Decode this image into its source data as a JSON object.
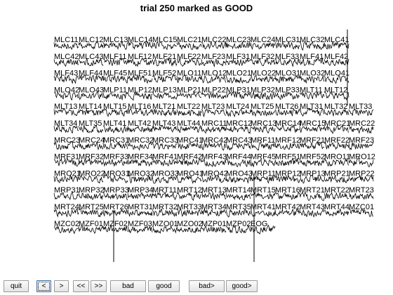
{
  "title": "trial 250 marked as GOOD",
  "channels": [
    [
      "MLC11",
      "MLC12",
      "MLC13",
      "MLC14",
      "MLC15",
      "MLC21",
      "MLC22",
      "MLC23",
      "MLC24",
      "MLC31",
      "MLC32",
      "MLC41"
    ],
    [
      "MLC42",
      "MLC43",
      "MLF11",
      "MLF12",
      "MLF21",
      "MLF22",
      "MLF23",
      "MLF31",
      "MLF32",
      "MLF33",
      "MLF41",
      "MLF42"
    ],
    [
      "MLF43",
      "MLF44",
      "MLF45",
      "MLF51",
      "MLF52",
      "MLO11",
      "MLO12",
      "MLO21",
      "MLO22",
      "MLO31",
      "MLO32",
      "MLO41"
    ],
    [
      "MLO42",
      "MLO43",
      "MLP11",
      "MLP12",
      "MLP13",
      "MLP21",
      "MLP22",
      "MLP31",
      "MLP32",
      "MLP33",
      "MLT11",
      "MLT12"
    ],
    [
      "MLT13",
      "MLT14",
      "MLT15",
      "MLT16",
      "MLT21",
      "MLT22",
      "MLT23",
      "MLT24",
      "MLT25",
      "MLT26",
      "MLT31",
      "MLT32",
      "MLT33"
    ],
    [
      "MLT34",
      "MLT35",
      "MLT41",
      "MLT42",
      "MLT43",
      "MLT44",
      "MRC11",
      "MRC12",
      "MRC13",
      "MRC14",
      "MRC15",
      "MRC21",
      "MRC22"
    ],
    [
      "MRC23",
      "MRC24",
      "MRC31",
      "MRC32",
      "MRC33",
      "MRC41",
      "MRC42",
      "MRC43",
      "MRF11",
      "MRF12",
      "MRF21",
      "MRF22",
      "MRF23"
    ],
    [
      "MRF31",
      "MRF32",
      "MRF33",
      "MRF34",
      "MRF41",
      "MRF42",
      "MRF43",
      "MRF44",
      "MRF45",
      "MRF51",
      "MRF52",
      "MRO11",
      "MRO12"
    ],
    [
      "MRO21",
      "MRO22",
      "MRO31",
      "MRO32",
      "MRO33",
      "MRO41",
      "MRO42",
      "MRO43",
      "MRP11",
      "MRP12",
      "MRP13",
      "MRP21",
      "MRP22"
    ],
    [
      "MRP31",
      "MRP32",
      "MRP33",
      "MRP34",
      "MRT11",
      "MRT12",
      "MRT13",
      "MRT14",
      "MRT15",
      "MRT16",
      "MRT21",
      "MRT22",
      "MRT23"
    ],
    [
      "MRT24",
      "MRT25",
      "MRT26",
      "MRT31",
      "MRT32",
      "MRT33",
      "MRT34",
      "MRT35",
      "MRT41",
      "MRT42",
      "MRT43",
      "MRT44",
      "MZC01"
    ],
    [
      "MZC02",
      "MZF01",
      "MZF02",
      "MZF03",
      "MZO01",
      "MZO02",
      "MZP01",
      "MZP02",
      "EOG"
    ]
  ],
  "buttons": [
    {
      "name": "quit-button",
      "label": "quit"
    },
    {
      "name": "previous-button",
      "label": "<"
    },
    {
      "name": "next-button",
      "label": ">"
    },
    {
      "name": "rewind-button",
      "label": "<<"
    },
    {
      "name": "fast-forward-button",
      "label": ">>"
    },
    {
      "name": "bad-button",
      "label": "bad"
    },
    {
      "name": "good-button",
      "label": "good"
    },
    {
      "name": "bad-next-button",
      "label": "bad>"
    },
    {
      "name": "good-next-button",
      "label": "good>"
    }
  ]
}
